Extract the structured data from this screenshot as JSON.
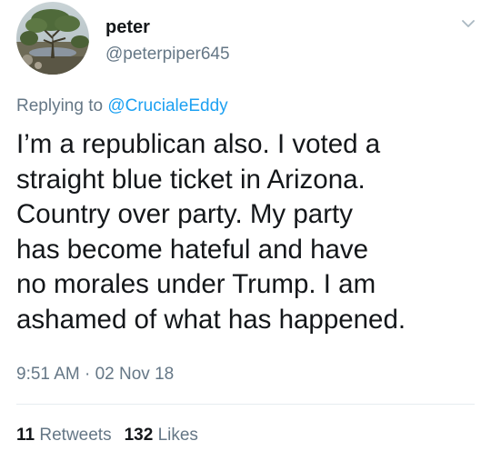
{
  "user": {
    "display_name": "peter",
    "handle": "@peterpiper645"
  },
  "reply": {
    "prefix": "Replying to ",
    "mention": "@CrucialeEddy"
  },
  "tweet": {
    "lines": [
      "I’m a republican also. I voted a",
      "straight blue ticket in Arizona.",
      "Country over party. My party",
      "has become hateful and have",
      "no morales under Trump. I am",
      "ashamed of what has happened."
    ],
    "timestamp": "9:51 AM · 02 Nov 18"
  },
  "stats": {
    "retweets_count": "11",
    "retweets_label": "Retweets",
    "likes_count": "132",
    "likes_label": "Likes"
  },
  "icons": {
    "avatar": "tree-landscape-photo",
    "menu": "chevron-down-icon"
  },
  "colors": {
    "text": "#14171a",
    "secondary": "#657786",
    "link": "#1da1f2",
    "divider": "#e6ecf0"
  }
}
